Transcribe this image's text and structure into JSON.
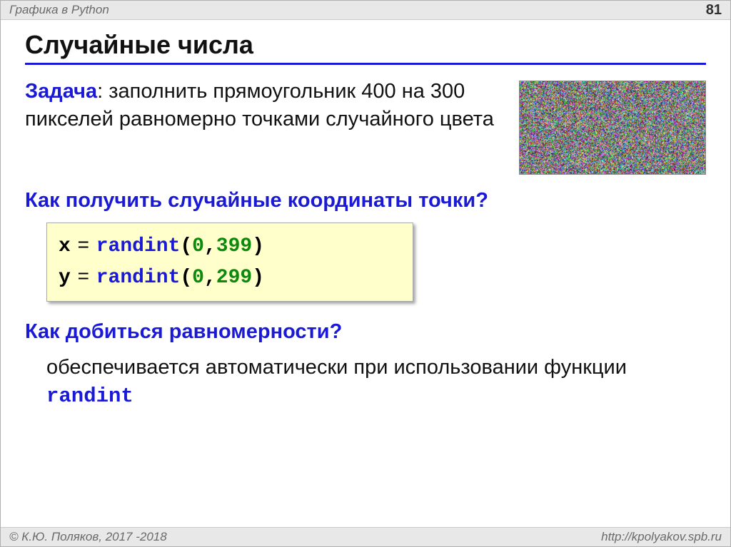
{
  "header": {
    "title": "Графика в Python",
    "page": "81"
  },
  "slide": {
    "heading": "Случайные числа",
    "task_label": "Задача",
    "task_text": ": заполнить прямоугольник 400 на 300 пикселей равномерно точками случайного цвета",
    "question1": "Как получить случайные координаты точки?",
    "code": {
      "line1": {
        "var": "x",
        "eq": " = ",
        "fn": "randint",
        "open": "(",
        "a": "0",
        "comma": ",",
        "b": "399",
        "close": ")"
      },
      "line2": {
        "var": "y",
        "eq": " = ",
        "fn": "randint",
        "open": "(",
        "a": "0",
        "comma": ",",
        "b": "299",
        "close": ")"
      }
    },
    "question2": "Как добиться равномерности?",
    "answer_pre": "обеспечивается автоматически при использовании  функции ",
    "answer_fn": "randint"
  },
  "footer": {
    "copyright": "© К.Ю. Поляков, 2017 -2018",
    "url": "http://kpolyakov.spb.ru"
  }
}
